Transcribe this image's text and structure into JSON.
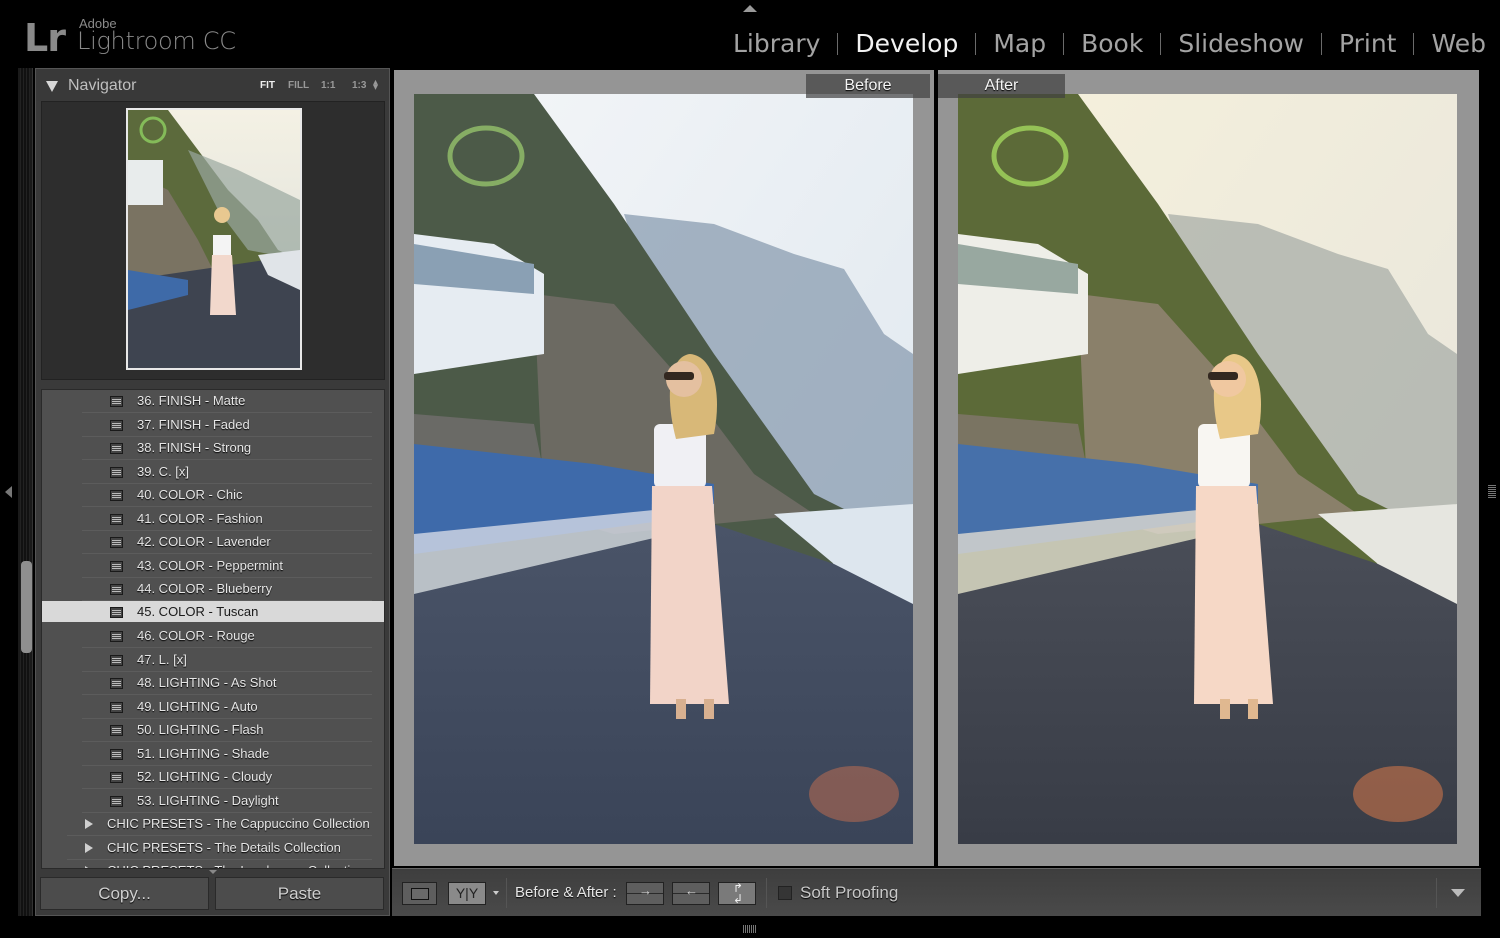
{
  "app": {
    "logo": "Lr",
    "brand_small": "Adobe",
    "brand_large": "Lightroom CC"
  },
  "modules": [
    {
      "label": "Library",
      "active": false
    },
    {
      "label": "Develop",
      "active": true
    },
    {
      "label": "Map",
      "active": false
    },
    {
      "label": "Book",
      "active": false
    },
    {
      "label": "Slideshow",
      "active": false
    },
    {
      "label": "Print",
      "active": false
    },
    {
      "label": "Web",
      "active": false
    }
  ],
  "navigator": {
    "title": "Navigator",
    "zoom_options": [
      "FIT",
      "FILL",
      "1:1",
      "1:3"
    ],
    "active_zoom": "FIT"
  },
  "presets": {
    "items": [
      "36. FINISH - Matte",
      "37. FINISH - Faded",
      "38. FINISH - Strong",
      "39. C. [x]",
      "40. COLOR - Chic",
      "41. COLOR - Fashion",
      "42. COLOR - Lavender",
      "43. COLOR - Peppermint",
      "44. COLOR - Blueberry",
      "45. COLOR - Tuscan",
      "46. COLOR - Rouge",
      "47. L. [x]",
      "48. LIGHTING - As Shot",
      "49. LIGHTING - Auto",
      "50. LIGHTING - Flash",
      "51. LIGHTING - Shade",
      "52. LIGHTING - Cloudy",
      "53. LIGHTING - Daylight"
    ],
    "selected": "45. COLOR - Tuscan",
    "folders": [
      "CHIC PRESETS - The Cappuccino Collection",
      "CHIC PRESETS - The Details Collection",
      "CHIC PRESETS - The Landscape Collection"
    ]
  },
  "buttons": {
    "copy": "Copy...",
    "paste": "Paste"
  },
  "views": {
    "before_label": "Before",
    "after_label": "After"
  },
  "toolbar": {
    "view_mode_label": "Y|Y",
    "before_after_label": "Before & After :",
    "soft_proofing_label": "Soft Proofing",
    "soft_proofing_checked": false
  }
}
